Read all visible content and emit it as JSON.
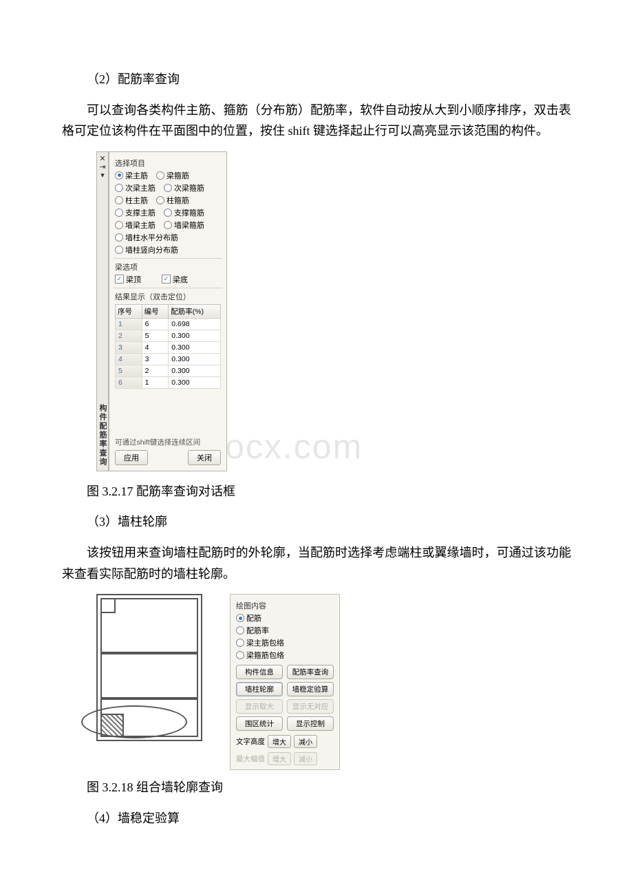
{
  "paragraphs": {
    "p1": "（2）配筋率查询",
    "p2": "可以查询各类构件主筋、箍筋（分布筋）配筋率，软件自动按从大到小顺序排序，双击表格可定位该构件在平面图中的位置，按住 shift 键选择起止行可以高亮显示该范围的构件。",
    "p3": "图 3.2.17 配筋率查询对话框",
    "p4": "（3）墙柱轮廓",
    "p5": "该按钮用来查询墙柱配筋时的外轮廓，当配筋时选择考虑端柱或翼缘墙时，可通过该功能来查看实际配筋时的墙柱轮廓。",
    "p6": "图 3.2.18 组合墙轮廓查询",
    "p7": "（4）墙稳定验算"
  },
  "watermark": "www.bdocx.com",
  "dlg1": {
    "vtab_title": "构件配筋率查询",
    "grp1": "选择项目",
    "radios": [
      [
        "梁主筋",
        "梁箍筋"
      ],
      [
        "次梁主筋",
        "次梁箍筋"
      ],
      [
        "柱主筋",
        "柱箍筋"
      ],
      [
        "支撑主筋",
        "支撑箍筋"
      ],
      [
        "墙梁主筋",
        "墙梁箍筋"
      ]
    ],
    "radio_single": [
      "墙柱水平分布筋",
      "墙柱竖向分布筋"
    ],
    "grp2": "梁选项",
    "check1": "梁顶",
    "check2": "梁底",
    "grp3": "结果显示（双击定位）",
    "th": [
      "序号",
      "编号",
      "配筋率(%)"
    ],
    "rows": [
      [
        "1",
        "6",
        "0.698"
      ],
      [
        "2",
        "5",
        "0.300"
      ],
      [
        "3",
        "4",
        "0.300"
      ],
      [
        "4",
        "3",
        "0.300"
      ],
      [
        "5",
        "2",
        "0.300"
      ],
      [
        "6",
        "1",
        "0.300"
      ]
    ],
    "hint": "可通过shift键选择连续区间",
    "btn_apply": "应用",
    "btn_close": "关闭"
  },
  "panel2": {
    "grp": "绘图内容",
    "radios": [
      "配筋",
      "配筋率",
      "梁主筋包络",
      "梁箍筋包络"
    ],
    "btns": [
      "构件信息",
      "配筋率查询",
      "墙柱轮廓",
      "墙稳定验算",
      "显示取大",
      "显示无对应",
      "围区统计",
      "显示控制"
    ],
    "txtrow1_label": "文字高度",
    "txtrow1_btn1": "增大",
    "txtrow1_btn2": "减小",
    "txtrow2_label": "最大幅值",
    "txtrow2_btn1": "增大",
    "txtrow2_btn2": "减小"
  }
}
